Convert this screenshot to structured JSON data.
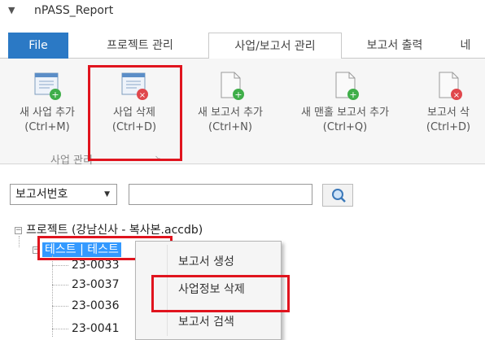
{
  "window": {
    "title": "nPASS_Report"
  },
  "ribbon": {
    "tabs": [
      {
        "label": "File"
      },
      {
        "label": "프로젝트 관리"
      },
      {
        "label": "사업/보고서 관리"
      },
      {
        "label": "보고서 출력"
      },
      {
        "label": "네"
      }
    ],
    "buttons": [
      {
        "label1": "새 사업 추가",
        "label2": "(Ctrl+M)",
        "icon": "add-project-icon"
      },
      {
        "label1": "사업 삭제",
        "label2": "(Ctrl+D)",
        "icon": "delete-project-icon"
      },
      {
        "label1": "새 보고서 추가",
        "label2": "(Ctrl+N)",
        "icon": "add-report-icon"
      },
      {
        "label1": "새 맨홀 보고서 추가",
        "label2": "(Ctrl+Q)",
        "icon": "add-manhole-report-icon"
      },
      {
        "label1": "보고서 삭",
        "label2": "(Ctrl+D)",
        "icon": "delete-report-icon"
      }
    ],
    "group_label": "사업 관리"
  },
  "search": {
    "combo_value": "보고서번호",
    "input_value": ""
  },
  "tree": {
    "root": "프로젝트 (강남신사 - 복사본.accdb)",
    "selected": "테스트 | 테스트",
    "children": [
      "23-0033",
      "23-0037",
      "23-0036",
      "23-0041"
    ]
  },
  "context_menu": {
    "items": [
      "보고서 생성",
      "사업정보 삭제",
      "보고서 검색"
    ]
  },
  "colors": {
    "accent": "#2b79c5",
    "highlight": "#e0141e",
    "selection": "#3399ff"
  }
}
